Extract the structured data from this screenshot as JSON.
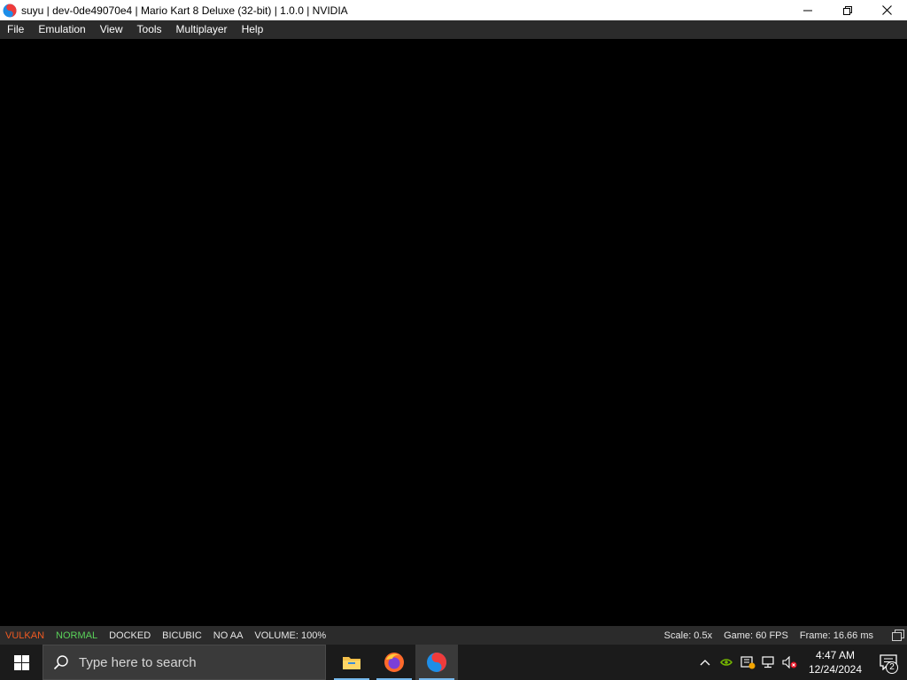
{
  "window": {
    "title": "suyu | dev-0de49070e4 | Mario Kart 8 Deluxe (32-bit) | 1.0.0 | NVIDIA",
    "app_icon": "suyu-logo-icon",
    "controls": [
      "minimize-icon",
      "restore-icon",
      "close-icon"
    ]
  },
  "menu": {
    "items": [
      "File",
      "Emulation",
      "View",
      "Tools",
      "Multiplayer",
      "Help"
    ]
  },
  "status": {
    "renderer": "VULKAN",
    "gpu_accuracy": "NORMAL",
    "dock_mode": "DOCKED",
    "filter": "BICUBIC",
    "aa": "NO AA",
    "volume": "VOLUME: 100%",
    "scale": "Scale: 0.5x",
    "game_fps": "Game: 60 FPS",
    "frame_time": "Frame: 16.66 ms",
    "colors": {
      "renderer": "#f05a22",
      "gpu_accuracy": "#5ad25a"
    }
  },
  "taskbar": {
    "search_placeholder": "Type here to search",
    "apps": [
      "file-explorer-icon",
      "firefox-icon",
      "suyu-icon"
    ],
    "clock_time": "4:47 AM",
    "clock_date": "12/24/2024",
    "notification_count": "2"
  }
}
